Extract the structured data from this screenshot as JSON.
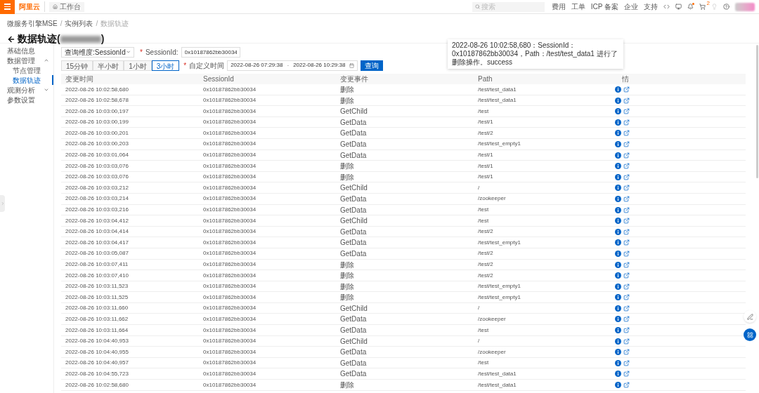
{
  "topbar": {
    "logo": "阿里云",
    "workbench": "工作台",
    "search": {
      "placeholder": "搜索"
    },
    "links": [
      "费用",
      "工单",
      "ICP 备案",
      "企业",
      "支持"
    ],
    "cart_badge": "2"
  },
  "breadcrumbs": {
    "items": [
      "微服务引擎MSE",
      "实例列表",
      "数据轨迹"
    ],
    "separator": "/"
  },
  "title": {
    "text": "数据轨迹(",
    "closing": ")"
  },
  "sidebar": {
    "items": [
      {
        "label": "基础信息",
        "selected": false
      },
      {
        "label": "数据管理",
        "selected": false,
        "expanded": true,
        "children": [
          {
            "label": "节点管理",
            "selected": false
          },
          {
            "label": "数据轨迹",
            "selected": true
          }
        ]
      },
      {
        "label": "观测分析",
        "selected": false,
        "expanded": false
      },
      {
        "label": "参数设置",
        "selected": false
      }
    ]
  },
  "query": {
    "required_mark": "*",
    "dimension": "查询维度:SessionId",
    "session_label": "SessionId:",
    "session_value": "0x10187862bb30034",
    "ranges": [
      {
        "label": "15分钟",
        "selected": false
      },
      {
        "label": "半小时",
        "selected": false
      },
      {
        "label": "1小时",
        "selected": false
      },
      {
        "label": "3小时",
        "selected": true
      }
    ],
    "custom_label": "自定义时间",
    "start": "2022-08-26 07:29:38",
    "separator": "-",
    "end": "2022-08-26 10:29:38",
    "button": "查询"
  },
  "table": {
    "columns": [
      "变更时间",
      "SessionId",
      "变更事件",
      "Path",
      "情"
    ],
    "rows": [
      [
        "2022-08-26 10:02:58,680",
        "0x10187862bb30034",
        "删除",
        "/test/test_data1"
      ],
      [
        "2022-08-26 10:02:58,678",
        "0x10187862bb30034",
        "删除",
        "/test/test_data1"
      ],
      [
        "2022-08-26 10:03:00,197",
        "0x10187862bb30034",
        "GetChild",
        "/test"
      ],
      [
        "2022-08-26 10:03:00,199",
        "0x10187862bb30034",
        "GetData",
        "/test/1"
      ],
      [
        "2022-08-26 10:03:00,201",
        "0x10187862bb30034",
        "GetData",
        "/test/2"
      ],
      [
        "2022-08-26 10:03:00,203",
        "0x10187862bb30034",
        "GetData",
        "/test/test_empty1"
      ],
      [
        "2022-08-26 10:03:01,064",
        "0x10187862bb30034",
        "GetData",
        "/test/1"
      ],
      [
        "2022-08-26 10:03:03,076",
        "0x10187862bb30034",
        "删除",
        "/test/1"
      ],
      [
        "2022-08-26 10:03:03,076",
        "0x10187862bb30034",
        "删除",
        "/test/1"
      ],
      [
        "2022-08-26 10:03:03,212",
        "0x10187862bb30034",
        "GetChild",
        "/"
      ],
      [
        "2022-08-26 10:03:03,214",
        "0x10187862bb30034",
        "GetData",
        "/zookeeper"
      ],
      [
        "2022-08-26 10:03:03,216",
        "0x10187862bb30034",
        "GetData",
        "/test"
      ],
      [
        "2022-08-26 10:03:04,412",
        "0x10187862bb30034",
        "GetChild",
        "/test"
      ],
      [
        "2022-08-26 10:03:04,414",
        "0x10187862bb30034",
        "GetData",
        "/test/2"
      ],
      [
        "2022-08-26 10:03:04,417",
        "0x10187862bb30034",
        "GetData",
        "/test/test_empty1"
      ],
      [
        "2022-08-26 10:03:05,087",
        "0x10187862bb30034",
        "GetData",
        "/test/2"
      ],
      [
        "2022-08-26 10:03:07,411",
        "0x10187862bb30034",
        "删除",
        "/test/2"
      ],
      [
        "2022-08-26 10:03:07,410",
        "0x10187862bb30034",
        "删除",
        "/test/2"
      ],
      [
        "2022-08-26 10:03:11,523",
        "0x10187862bb30034",
        "删除",
        "/test/test_empty1"
      ],
      [
        "2022-08-26 10:03:11,525",
        "0x10187862bb30034",
        "删除",
        "/test/test_empty1"
      ],
      [
        "2022-08-26 10:03:11,660",
        "0x10187862bb30034",
        "GetChild",
        "/"
      ],
      [
        "2022-08-26 10:03:11,662",
        "0x10187862bb30034",
        "GetData",
        "/zookeeper"
      ],
      [
        "2022-08-26 10:03:11,664",
        "0x10187862bb30034",
        "GetData",
        "/test"
      ],
      [
        "2022-08-26 10:04:40,953",
        "0x10187862bb30034",
        "GetChild",
        "/"
      ],
      [
        "2022-08-26 10:04:40,955",
        "0x10187862bb30034",
        "GetData",
        "/zookeeper"
      ],
      [
        "2022-08-26 10:04:40,957",
        "0x10187862bb30034",
        "GetData",
        "/test"
      ],
      [
        "2022-08-26 10:04:55,723",
        "0x10187862bb30034",
        "GetData",
        "/test/test_data1"
      ],
      [
        "2022-08-26 10:02:58,680",
        "0x10187862bb30034",
        "删除",
        "/test/test_data1"
      ]
    ]
  },
  "tooltip": {
    "text": "2022-08-26 10:02:58,680：SessionId：0x10187862bb30034，Path：/test/test_data1 进行了删除操作。success"
  }
}
